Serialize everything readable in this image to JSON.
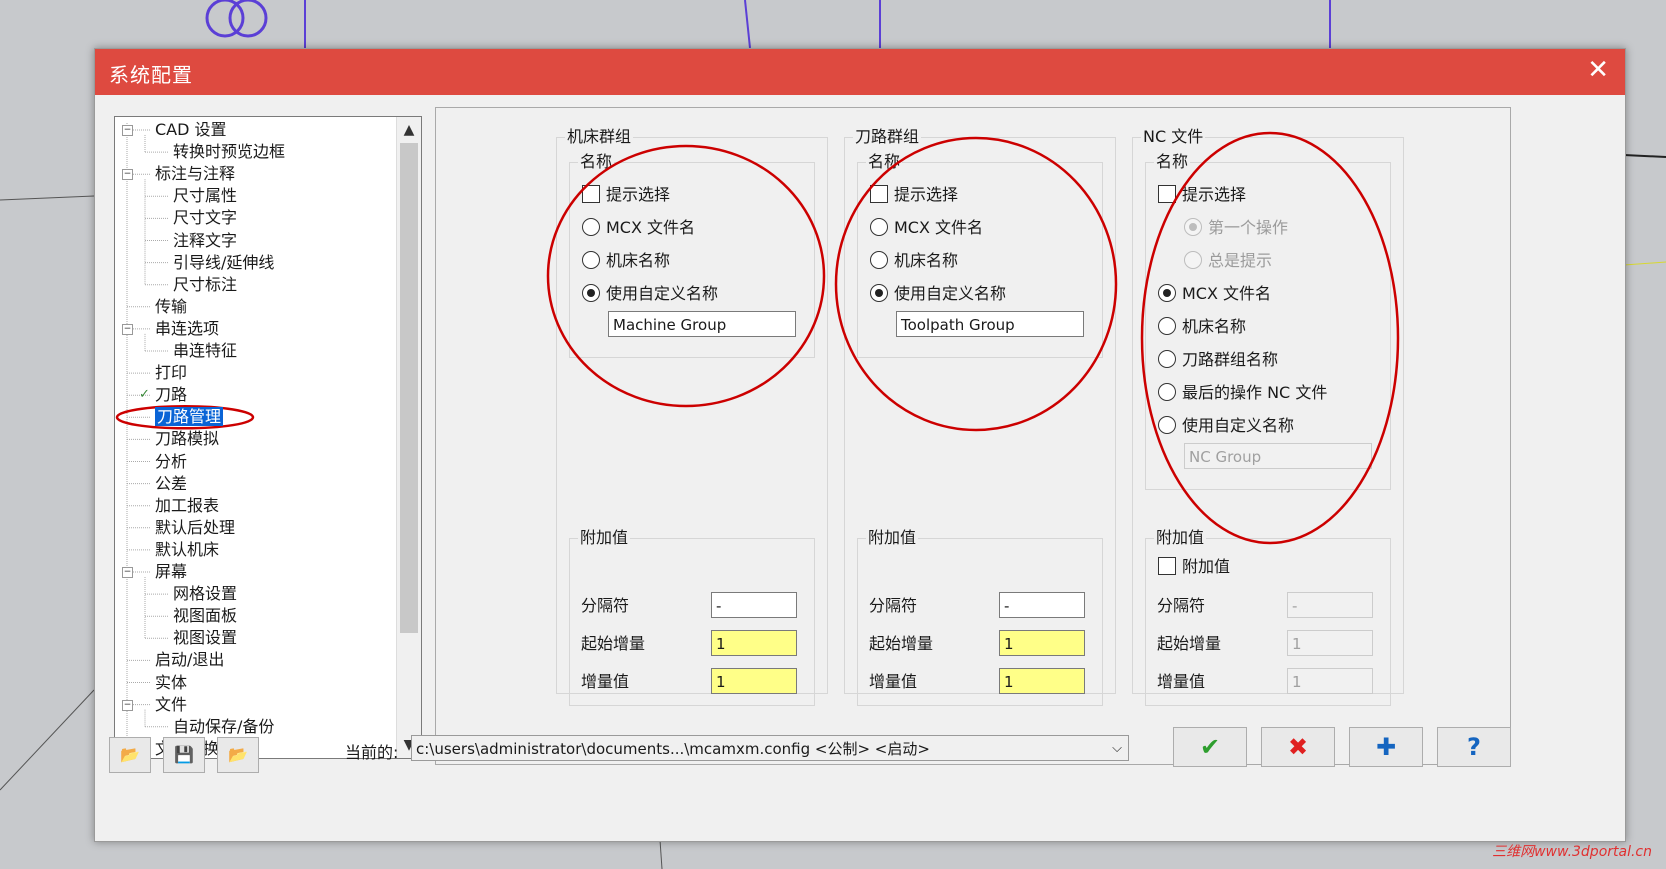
{
  "dialog": {
    "title": "系统配置",
    "close": "✕"
  },
  "tree": {
    "items": [
      {
        "label": "CAD 设置",
        "level": 0,
        "expander": "−"
      },
      {
        "label": "转换时预览边框",
        "level": 1
      },
      {
        "label": "标注与注释",
        "level": 0,
        "expander": "−"
      },
      {
        "label": "尺寸属性",
        "level": 1
      },
      {
        "label": "尺寸文字",
        "level": 1
      },
      {
        "label": "注释文字",
        "level": 1
      },
      {
        "label": "引导线/延伸线",
        "level": 1
      },
      {
        "label": "尺寸标注",
        "level": 1
      },
      {
        "label": "传输",
        "level": 0
      },
      {
        "label": "串连选项",
        "level": 0,
        "expander": "−"
      },
      {
        "label": "串连特征",
        "level": 1
      },
      {
        "label": "打印",
        "level": 0
      },
      {
        "label": "刀路",
        "level": 0,
        "checked": true
      },
      {
        "label": "刀路管理",
        "level": 0,
        "selected": true
      },
      {
        "label": "刀路模拟",
        "level": 0
      },
      {
        "label": "分析",
        "level": 0
      },
      {
        "label": "公差",
        "level": 0
      },
      {
        "label": "加工报表",
        "level": 0
      },
      {
        "label": "默认后处理",
        "level": 0
      },
      {
        "label": "默认机床",
        "level": 0
      },
      {
        "label": "屏幕",
        "level": 0,
        "expander": "−"
      },
      {
        "label": "网格设置",
        "level": 1
      },
      {
        "label": "视图面板",
        "level": 1
      },
      {
        "label": "视图设置",
        "level": 1
      },
      {
        "label": "启动/退出",
        "level": 0
      },
      {
        "label": "实体",
        "level": 0
      },
      {
        "label": "文件",
        "level": 0,
        "expander": "−"
      },
      {
        "label": "自动保存/备份",
        "level": 1
      },
      {
        "label": "文件转换",
        "level": 0
      }
    ]
  },
  "machine": {
    "group_title": "机床群组",
    "name_title": "名称",
    "prompt": "提示选择",
    "mcx": "MCX 文件名",
    "machine_name": "机床名称",
    "custom": "使用自定义名称",
    "custom_value": "Machine Group",
    "extra_title": "附加值",
    "sep_label": "分隔符",
    "sep_value": "-",
    "start_label": "起始增量",
    "start_value": "1",
    "inc_label": "增量值",
    "inc_value": "1"
  },
  "toolpath": {
    "group_title": "刀路群组",
    "name_title": "名称",
    "prompt": "提示选择",
    "mcx": "MCX 文件名",
    "machine_name": "机床名称",
    "custom": "使用自定义名称",
    "custom_value": "Toolpath Group",
    "extra_title": "附加值",
    "sep_label": "分隔符",
    "sep_value": "-",
    "start_label": "起始增量",
    "start_value": "1",
    "inc_label": "增量值",
    "inc_value": "1"
  },
  "nc": {
    "group_title": "NC 文件",
    "name_title": "名称",
    "prompt": "提示选择",
    "first_op": "第一个操作",
    "always_prompt": "总是提示",
    "mcx": "MCX 文件名",
    "machine_name": "机床名称",
    "tp_group_name": "刀路群组名称",
    "last_op": "最后的操作 NC 文件",
    "custom": "使用自定义名称",
    "custom_value": "NC Group",
    "extra_title": "附加值",
    "extra_check": "附加值",
    "sep_label": "分隔符",
    "sep_value": "-",
    "start_label": "起始增量",
    "start_value": "1",
    "inc_label": "增量值",
    "inc_value": "1"
  },
  "footer": {
    "current_label": "当前的:",
    "current_value": "c:\\users\\administrator\\documents...\\mcamxm.config <公制> <启动>",
    "open_icon": "📂",
    "save_icon": "💾",
    "merge_icon": "📂",
    "ok": "✔",
    "cancel": "✖",
    "add": "✚",
    "help": "?"
  },
  "watermark": "三维网www.3dportal.cn",
  "colors": {
    "title_bar": "#de4a40",
    "highlight": "#0a64d6",
    "annotation": "#cc0000",
    "ok": "#2e9e2e",
    "cancel": "#e02020",
    "add": "#1565c0"
  }
}
